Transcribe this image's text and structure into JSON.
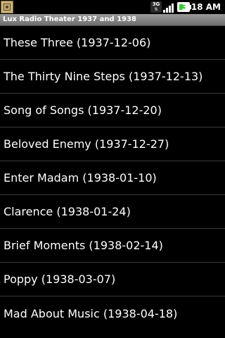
{
  "status_bar": {
    "app_icon": "radio-app-icon",
    "network_label": "3G",
    "network_icon": "network-3g-icon",
    "signal_icon": "signal-strength-icon",
    "battery_icon": "battery-charging-icon",
    "time": "3:18 AM"
  },
  "header": {
    "title": "Lux Radio Theater 1937 and 1938"
  },
  "episodes": [
    {
      "label": "These Three (1937-12-06)"
    },
    {
      "label": "The Thirty Nine Steps (1937-12-13)"
    },
    {
      "label": "Song of Songs (1937-12-20)"
    },
    {
      "label": "Beloved Enemy (1937-12-27)"
    },
    {
      "label": "Enter Madam (1938-01-10)"
    },
    {
      "label": "Clarence (1938-01-24)"
    },
    {
      "label": "Brief Moments (1938-02-14)"
    },
    {
      "label": "Poppy (1938-03-07)"
    },
    {
      "label": "Mad About Music (1938-04-18)"
    }
  ],
  "colors": {
    "background": "#000000",
    "text": "#ffffff",
    "divider": "#3a3a3a",
    "title_bar": "#7f7f7f",
    "battery_fill": "#33cc33"
  }
}
